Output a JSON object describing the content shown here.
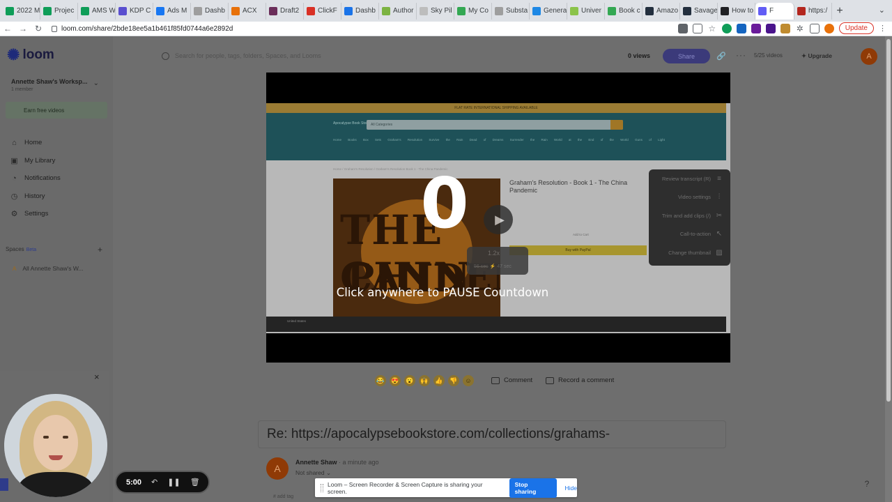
{
  "browser": {
    "tabs": [
      {
        "label": "2022 M",
        "color": "#0f9d58"
      },
      {
        "label": "Projec",
        "color": "#0f9d58"
      },
      {
        "label": "AMS W",
        "color": "#0f9d58"
      },
      {
        "label": "KDP C",
        "color": "#5a4fcf"
      },
      {
        "label": "Ads M",
        "color": "#1877f2"
      },
      {
        "label": "Dashb",
        "color": "#9e9e9e"
      },
      {
        "label": "ACX",
        "color": "#e8710a"
      },
      {
        "label": "Draft2",
        "color": "#6b2e5a"
      },
      {
        "label": "ClickF",
        "color": "#d93025"
      },
      {
        "label": "Dashb",
        "color": "#1a73e8"
      },
      {
        "label": "Author",
        "color": "#7cb342"
      },
      {
        "label": "Sky Pil",
        "color": "#bdbdbd"
      },
      {
        "label": "My Co",
        "color": "#34a853"
      },
      {
        "label": "Substa",
        "color": "#9e9e9e"
      },
      {
        "label": "Genera",
        "color": "#1e88e5"
      },
      {
        "label": "Univer",
        "color": "#8bc34a"
      },
      {
        "label": "Book c",
        "color": "#34a853"
      },
      {
        "label": "Amazo",
        "color": "#232f3e"
      },
      {
        "label": "Savage",
        "color": "#232f3e"
      },
      {
        "label": "How to",
        "color": "#202124"
      },
      {
        "label": "F",
        "color": "#625df5",
        "active": true
      },
      {
        "label": "https:/",
        "color": "#b3261e"
      }
    ],
    "new_tab": "+",
    "tab_menu": "⌄",
    "url": "loom.com/share/2bde18ee5a1b461f85fd0744a6e2892d",
    "update_label": "Update"
  },
  "loom": {
    "logo_text": "loom",
    "workspace_name": "Annette Shaw's Worksp...",
    "workspace_meta": "1 member",
    "earn_label": "Earn free videos",
    "nav": [
      {
        "label": "Home",
        "icon": "home-icon",
        "glyph": "⌂"
      },
      {
        "label": "My Library",
        "icon": "library-icon",
        "glyph": "▣"
      },
      {
        "label": "Notifications",
        "icon": "bell-icon",
        "glyph": "◔"
      },
      {
        "label": "History",
        "icon": "clock-icon",
        "glyph": "◷"
      },
      {
        "label": "Settings",
        "icon": "gear-icon",
        "glyph": "⚙"
      }
    ],
    "spaces_label": "Spaces",
    "spaces_beta": "Beta",
    "spaces_item": "All Annette Shaw's W...",
    "spaces_item_initial": "A",
    "search_placeholder": "Search for people, tags, folders, Spaces, and Looms",
    "views": "0 views",
    "share_label": "Share",
    "videos_count": "5/25 videos",
    "upgrade_label": "Upgrade",
    "user_initial": "A"
  },
  "video": {
    "countdown": "0",
    "countdown_hint": "Click anywhere to PAUSE Countdown",
    "speed": "1.2x",
    "seconds": "47 sec",
    "seconds_old": "56 sec",
    "frame": {
      "banner": "FLAT RATE INTERNATIONAL SHIPPING AVAILABLE",
      "store_name": "Apocalypse Book Store",
      "search_placeholder": "All Categories",
      "nav_links": "Home Books Box Sets Graham's Resolution Survive the Rain Dead of Dreams Surrender the Rain World at the End of the World Guns of Light",
      "breadcrumbs": "Home / Graham's Resolution / Graham's Resolution Book 1 - The China Pandemic",
      "book_title": "Graham's Resolution - Book 1 - The China Pandemic",
      "cover_top": "THE CHIN",
      "cover_bottom": "PANDEMIC",
      "buy_label": "Buy with PayPal",
      "price_note": "Add to Cart",
      "country": "United States"
    },
    "tools": [
      {
        "label": "Review transcript (R)",
        "icon": "transcript-icon",
        "glyph": "≡"
      },
      {
        "label": "Video settings",
        "icon": "sliders-icon",
        "glyph": "⫶"
      },
      {
        "label": "Trim and add clips (/)",
        "icon": "scissors-icon",
        "glyph": "✂"
      },
      {
        "label": "Call-to-action",
        "icon": "cursor-icon",
        "glyph": "↖"
      },
      {
        "label": "Change thumbnail",
        "icon": "image-icon",
        "glyph": "▨"
      }
    ]
  },
  "below_video": {
    "reactions": [
      "😂",
      "😍",
      "😮",
      "🙌",
      "👍",
      "👎",
      "☺"
    ],
    "comment_label": "Comment",
    "record_comment_label": "Record a comment",
    "title": "Re: https://apocalypsebookstore.com/collections/grahams-",
    "owner_name": "Annette Shaw",
    "owner_time": "· a minute ago",
    "owner_initial": "A",
    "shared_status": "Not shared",
    "add_tag": "# add tag",
    "help": "?"
  },
  "recorder": {
    "time": "5:00",
    "close": "×",
    "banner_message": "Loom – Screen Recorder & Screen Capture is sharing your screen.",
    "stop_label": "Stop sharing",
    "hide_label": "Hide"
  }
}
